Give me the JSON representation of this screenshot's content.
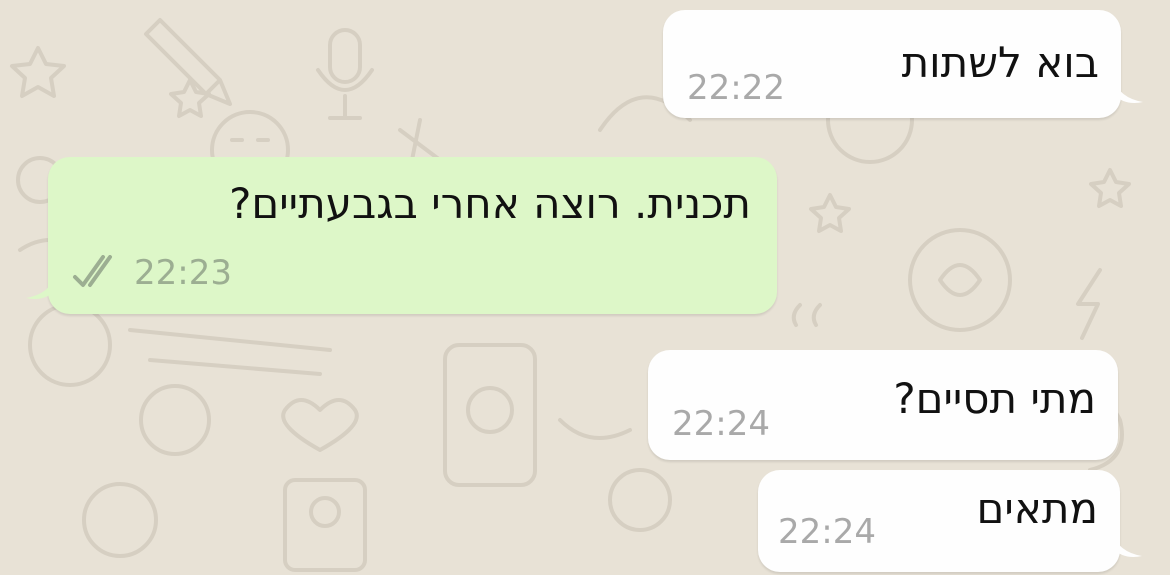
{
  "chat": {
    "messages": [
      {
        "direction": "incoming",
        "text": "בוא לשתות",
        "time": "22:22"
      },
      {
        "direction": "outgoing",
        "text": "תכנית. רוצה אחרי בגבעתיים?",
        "time": "22:23",
        "status": "double-check-icon"
      },
      {
        "direction": "incoming",
        "text": "מתי תסיים?",
        "time": "22:24"
      },
      {
        "direction": "incoming",
        "text": "מתאים",
        "time": "22:24"
      }
    ]
  },
  "colors": {
    "background": "#e8e2d6",
    "incoming_bubble": "#fefefe",
    "outgoing_bubble": "#ddf7c8",
    "time_text": "#a9a9a9",
    "outgoing_time_text": "#9cae92"
  }
}
